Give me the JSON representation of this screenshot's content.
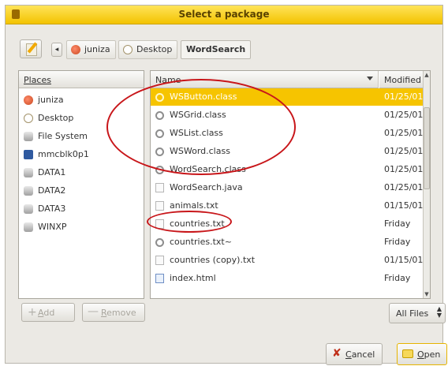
{
  "window": {
    "title": "Select a package"
  },
  "pathbar": {
    "crumbs": [
      {
        "label": "juniza",
        "icon": "home-folder-icon"
      },
      {
        "label": "Desktop",
        "icon": "desktop-icon"
      },
      {
        "label": "WordSearch",
        "active": true
      }
    ]
  },
  "places": {
    "header": "Places",
    "items": [
      {
        "label": "juniza",
        "icon": "home-folder-icon"
      },
      {
        "label": "Desktop",
        "icon": "desktop-icon"
      },
      {
        "label": "File System",
        "icon": "drive-icon"
      },
      {
        "label": "mmcblk0p1",
        "icon": "harddisk-icon"
      },
      {
        "label": "DATA1",
        "icon": "drive-icon"
      },
      {
        "label": "DATA2",
        "icon": "drive-icon"
      },
      {
        "label": "DATA3",
        "icon": "drive-icon"
      },
      {
        "label": "WINXP",
        "icon": "drive-icon"
      }
    ]
  },
  "files": {
    "col_name": "Name",
    "col_modified": "Modified",
    "rows": [
      {
        "name": "WSButton.class",
        "modified": "01/25/01",
        "type": "class",
        "selected": true
      },
      {
        "name": "WSGrid.class",
        "modified": "01/25/01",
        "type": "class"
      },
      {
        "name": "WSList.class",
        "modified": "01/25/01",
        "type": "class"
      },
      {
        "name": "WSWord.class",
        "modified": "01/25/01",
        "type": "class"
      },
      {
        "name": "WordSearch.class",
        "modified": "01/25/01",
        "type": "class"
      },
      {
        "name": "WordSearch.java",
        "modified": "01/25/01",
        "type": "doc"
      },
      {
        "name": "animals.txt",
        "modified": "01/15/01",
        "type": "doc"
      },
      {
        "name": "countries.txt",
        "modified": "Friday",
        "type": "doc"
      },
      {
        "name": "countries.txt~",
        "modified": "Friday",
        "type": "class"
      },
      {
        "name": "countries (copy).txt",
        "modified": "01/15/01",
        "type": "doc"
      },
      {
        "name": "index.html",
        "modified": "Friday",
        "type": "html"
      }
    ]
  },
  "buttons": {
    "add_prefix": "",
    "add_mnemonic": "A",
    "add_rest": "dd",
    "remove_mnemonic": "R",
    "remove_rest": "emove",
    "filter": "All Files",
    "cancel_mnemonic": "C",
    "cancel_rest": "ancel",
    "open_mnemonic": "O",
    "open_rest": "pen"
  },
  "colors": {
    "accent": "#f6c400",
    "annotation": "#c8161a"
  }
}
